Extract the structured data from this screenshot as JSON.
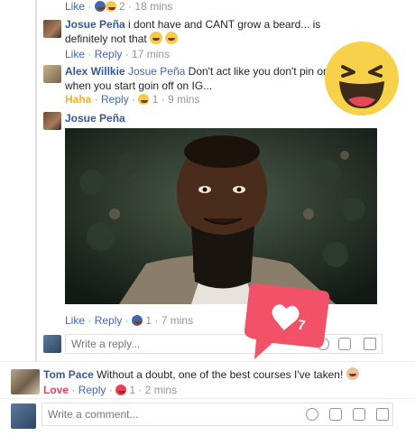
{
  "comments": [
    {
      "actions": {
        "like": "Like",
        "reply": "Reply",
        "count": "2",
        "time": "18 mins"
      }
    },
    {
      "author": "Josue Peña",
      "text": "i dont have and CANT grow a beard... is definitely not that",
      "actions": {
        "like": "Like",
        "reply": "Reply",
        "time": "17 mins"
      }
    },
    {
      "author": "Alex Willkie",
      "mention": "Josue Peña",
      "text": "Don't act like you don't pin one to your... when you start goin off on IG...",
      "text_line1": "Don't act like you don't pin one to",
      "text_line2": "when you start goin off on IG...",
      "actions": {
        "reaction": "Haha",
        "reply": "Reply",
        "count": "1",
        "time": "9 mins"
      }
    },
    {
      "author": "Josue Peña",
      "actions": {
        "like": "Like",
        "reply": "Reply",
        "count": "1",
        "time": "7 mins"
      }
    },
    {
      "author": "Tom Pace",
      "text": "Without a doubt, one of the best courses I've taken!",
      "actions": {
        "reaction": "Love",
        "reply": "Reply",
        "count": "1",
        "time": "2 mins"
      }
    }
  ],
  "reply_input": {
    "placeholder": "Write a reply..."
  },
  "comment_input": {
    "placeholder": "Write a comment..."
  },
  "notification": {
    "count": "7"
  },
  "colors": {
    "link": "#4267b2",
    "name": "#365899",
    "haha": "#f7b125",
    "love": "#f33e58",
    "badge": "#f25268"
  }
}
